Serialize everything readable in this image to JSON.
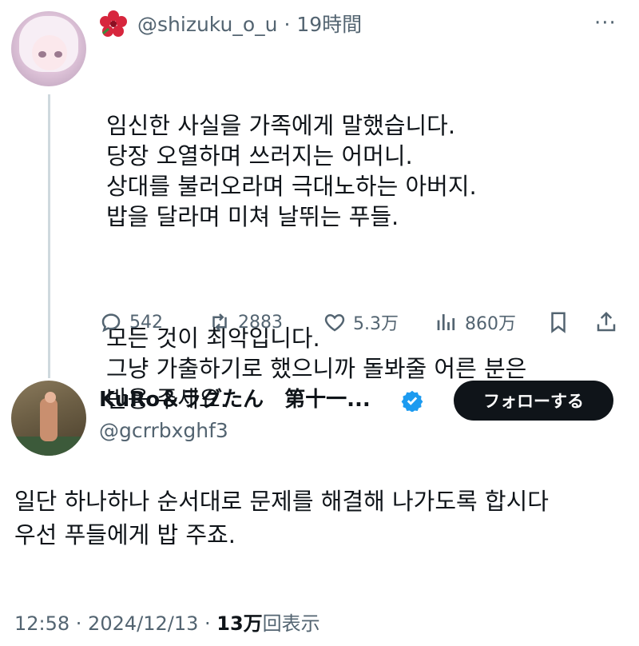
{
  "tweet": {
    "handle": "@shizuku_o_u",
    "time": "· 19時間",
    "more_label": "···",
    "paragraphs": [
      "임신한 사실을 가족에게 말했습니다.\n당장 오열하며 쓰러지는 어머니.\n상대를 불러오라며 극대노하는 아버지.\n밥을 달라며 미쳐 날뛰는 푸들.",
      "모든 것이 최악입니다.\n그냥 가출하기로 했으니까 돌봐줄 어른 분은\n반응 주세요."
    ],
    "actions": {
      "replies": "542",
      "retweets": "2883",
      "likes": "5.3万",
      "views": "860万"
    },
    "icons": [
      "hibiscus-icon",
      "reply-icon",
      "retweet-icon",
      "like-icon",
      "views-icon",
      "bookmark-icon",
      "share-icon"
    ]
  },
  "reply": {
    "name": "KuRo＆ラグたん　第十一...",
    "handle": "@gcrrbxghf3",
    "follow_label": "フォローする",
    "text": "일단 하나하나 순서대로 문제를 해결해 나가도록 합시다\n우선 푸들에게 밥 주죠.",
    "meta": {
      "time_date": "12:58 · 2024/12/13 · ",
      "views_count": "13万",
      "views_label": "回表示"
    }
  },
  "colors": {
    "text": "#0f1419",
    "secondary": "#536471",
    "verified": "#1d9bf0",
    "follow_bg": "#0f1419",
    "thread_line": "#cfd9de"
  }
}
